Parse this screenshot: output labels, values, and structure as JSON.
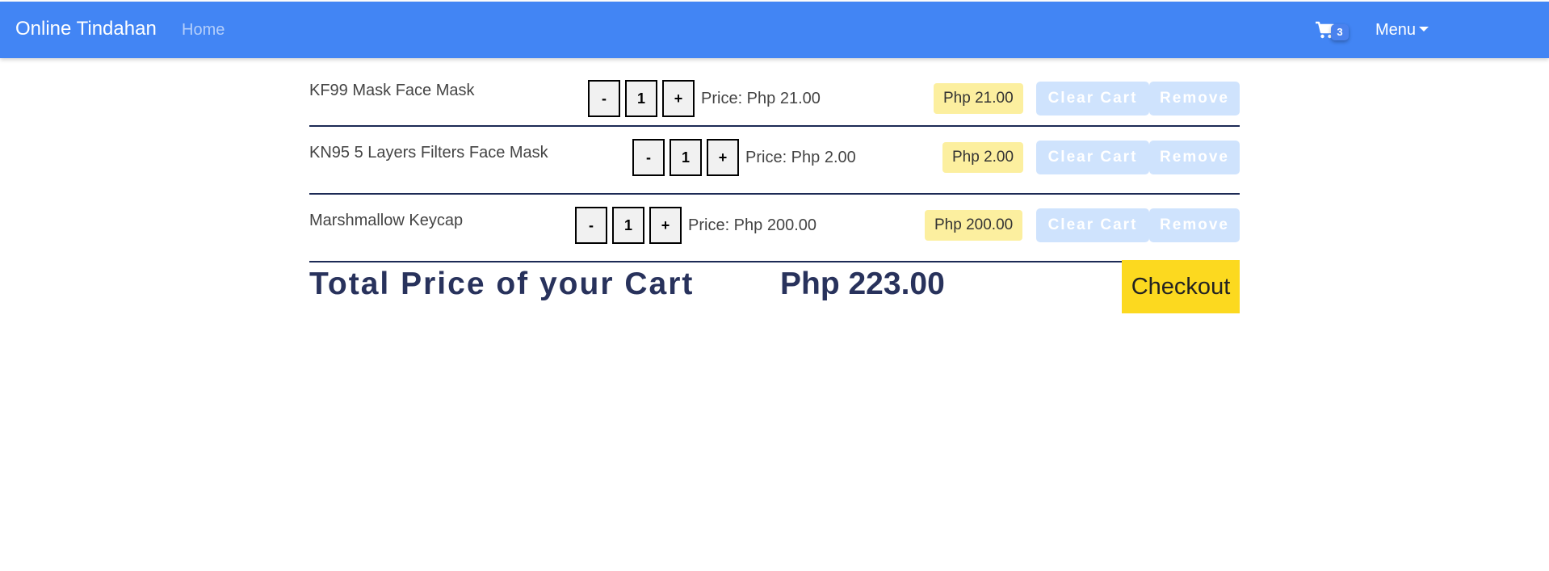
{
  "navbar": {
    "brand": "Online Tindahan",
    "home_label": "Home",
    "cart_icon": "shopping-cart-icon",
    "cart_count": "3",
    "menu_label": "Menu"
  },
  "cart": {
    "items": [
      {
        "name": "KF99 Mask Face Mask",
        "decrement": "-",
        "quantity": "1",
        "increment": "+",
        "unit_price": "Price: Php 21.00",
        "subtotal": "Php 21.00",
        "clear_label": "Clear Cart",
        "remove_label": "Remove"
      },
      {
        "name": "KN95 5 Layers Filters Face Mask",
        "decrement": "-",
        "quantity": "1",
        "increment": "+",
        "unit_price": "Price: Php 2.00",
        "subtotal": "Php 2.00",
        "clear_label": "Clear Cart",
        "remove_label": "Remove"
      },
      {
        "name": "Marshmallow Keycap",
        "decrement": "-",
        "quantity": "1",
        "increment": "+",
        "unit_price": "Price: Php 200.00",
        "subtotal": "Php 200.00",
        "clear_label": "Clear Cart",
        "remove_label": "Remove"
      }
    ],
    "total_label": "Total Price of your Cart",
    "total_value": "Php 223.00",
    "checkout_label": "Checkout"
  },
  "colors": {
    "navbar": "#4285f4",
    "price_badge": "#fcef9f",
    "checkout": "#fcd91f",
    "faded_button": "#cfe3fd",
    "total_text": "#28325c"
  }
}
